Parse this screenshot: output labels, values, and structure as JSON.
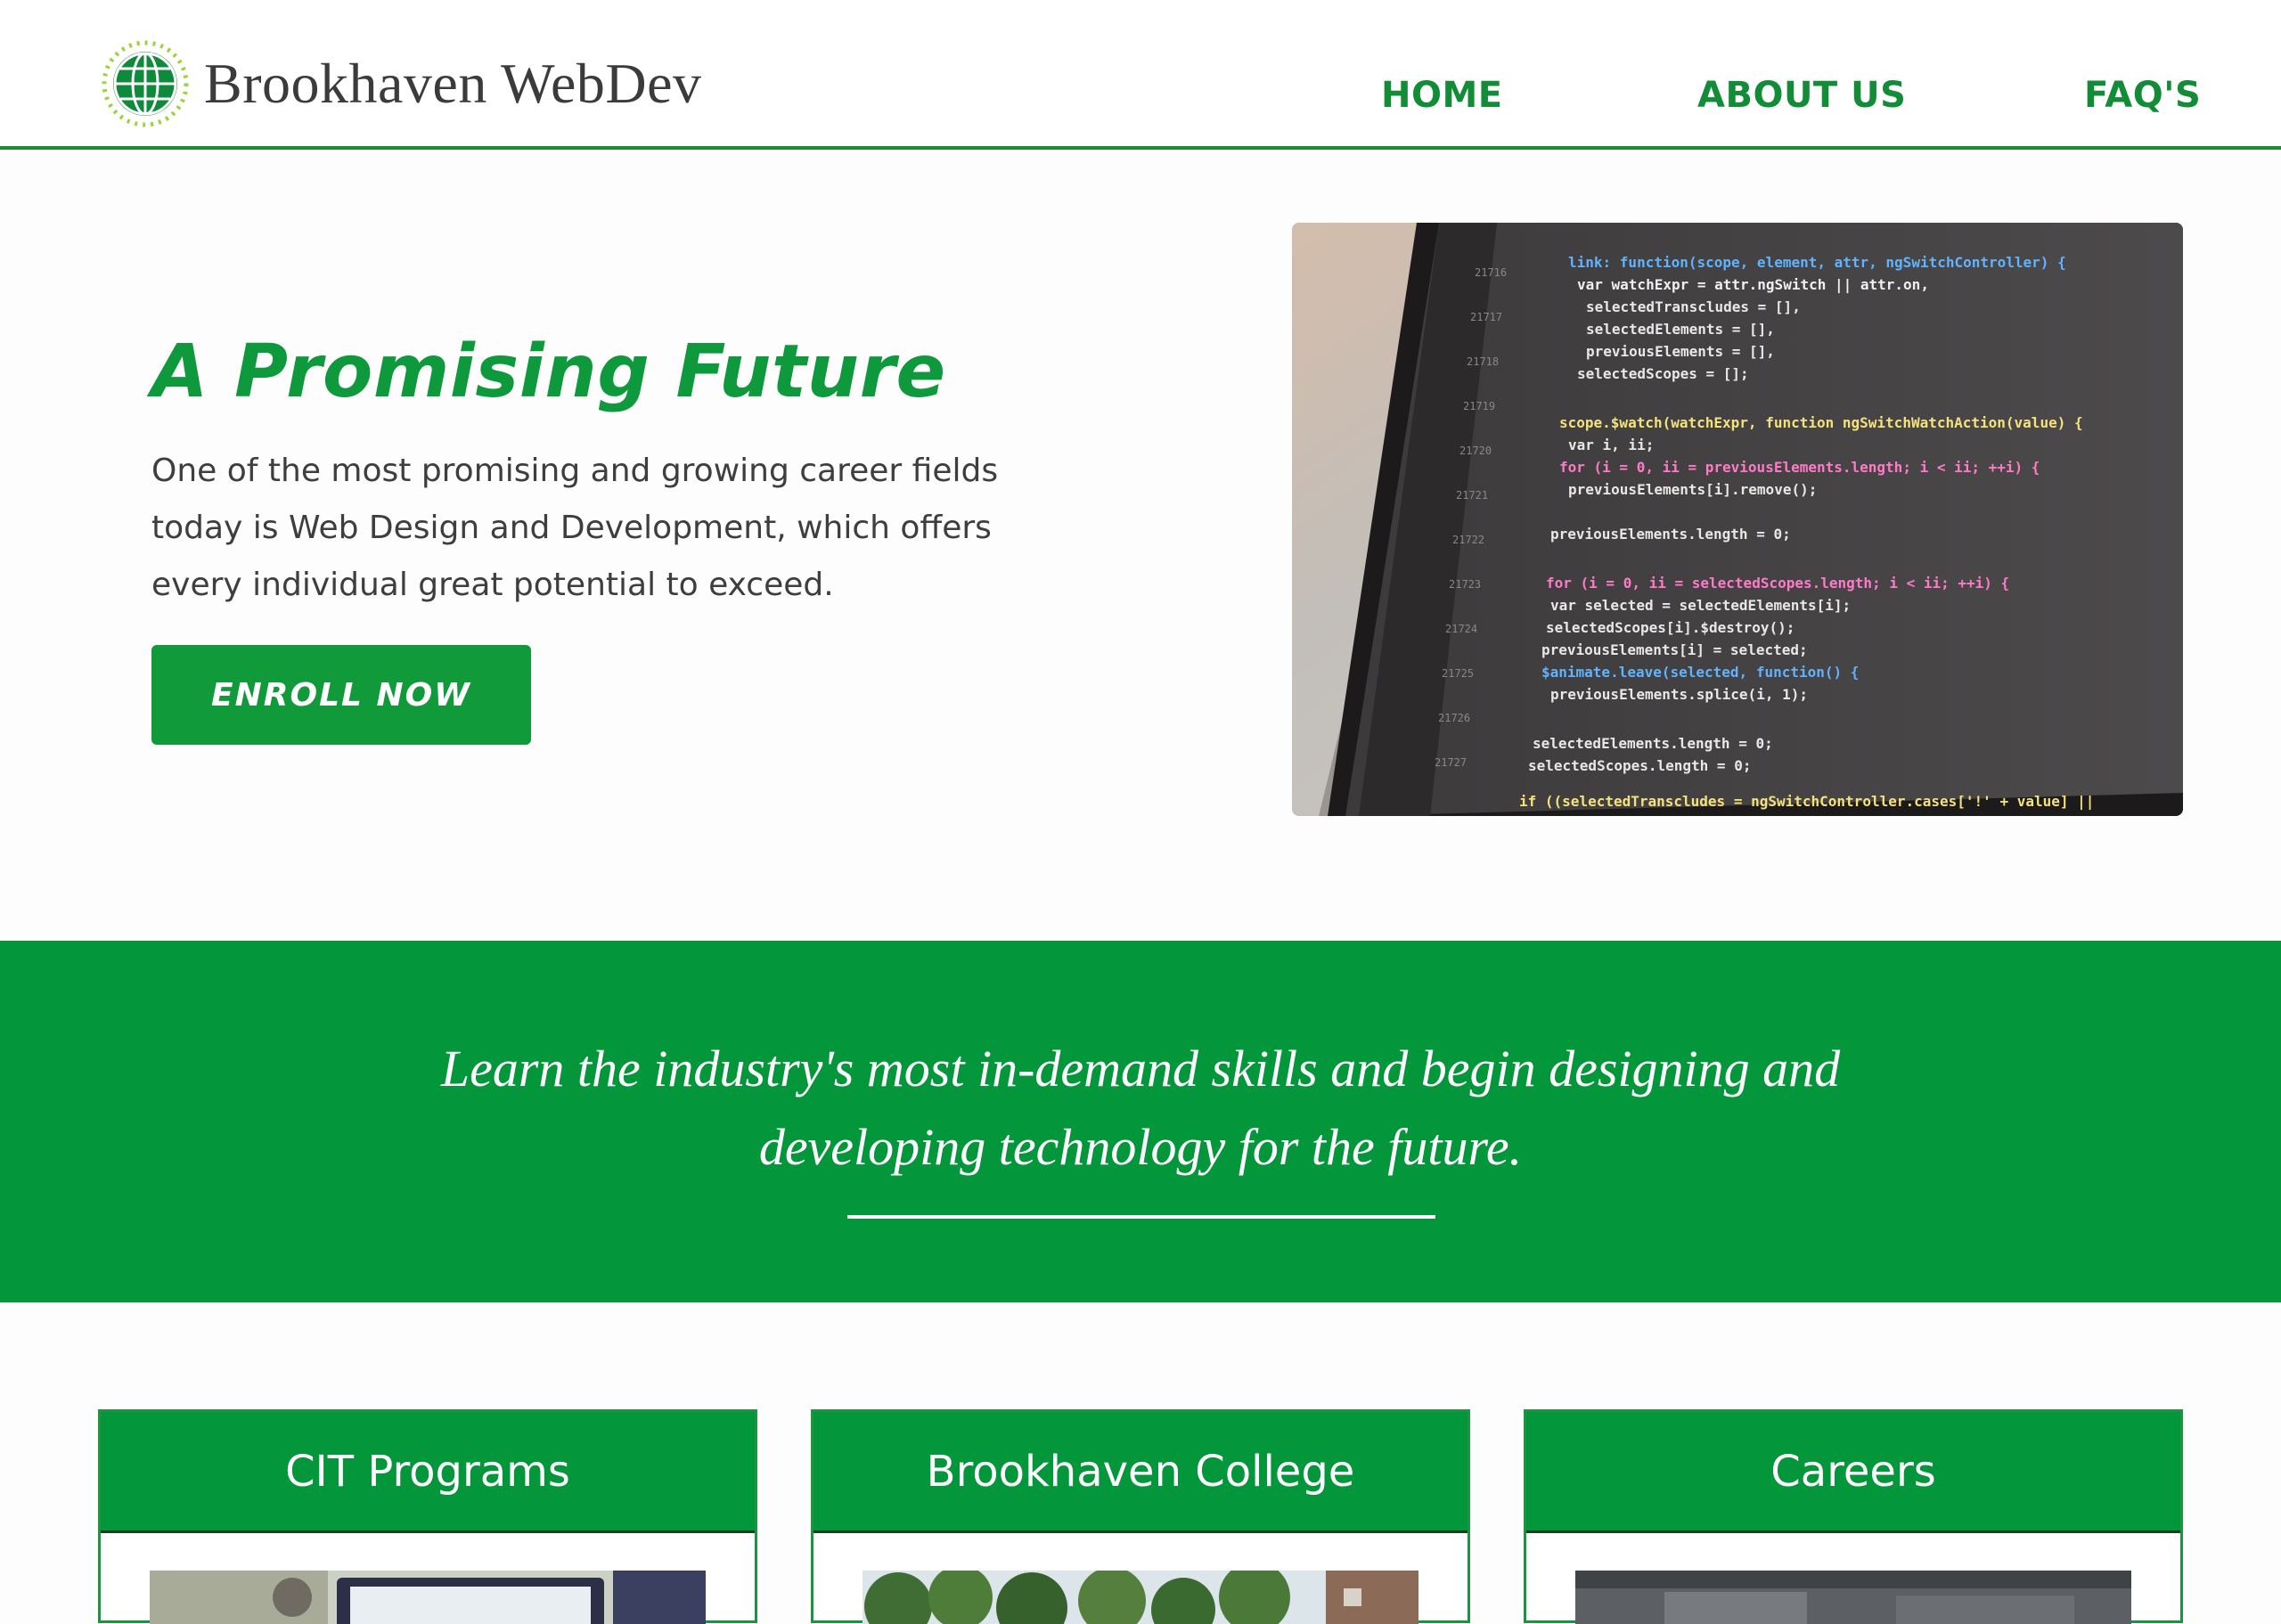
{
  "brand": {
    "name": "Brookhaven WebDev",
    "color": "#138c37"
  },
  "nav": {
    "items": [
      {
        "label": "HOME"
      },
      {
        "label": "ABOUT US"
      },
      {
        "label": "FAQ'S"
      }
    ]
  },
  "hero": {
    "title": "A Promising Future",
    "text": "One of the most promising and growing career fields today is Web Design and Development, which offers every individual great potential to exceed.",
    "button_label": "ENROLL NOW",
    "image_icon": "code-on-laptop-photo"
  },
  "banner": {
    "line1": "Learn the industry's most in-demand skills and begin designing and",
    "line2": "developing technology for the future."
  },
  "cards": [
    {
      "title": "CIT Programs",
      "image_icon": "computer-classroom-photo"
    },
    {
      "title": "Brookhaven College",
      "image_icon": "campus-trees-photo"
    },
    {
      "title": "Careers",
      "image_icon": "office-photo"
    }
  ],
  "colors": {
    "accent": "#03963a",
    "text": "#3e3e3e",
    "white": "#ffffff"
  }
}
